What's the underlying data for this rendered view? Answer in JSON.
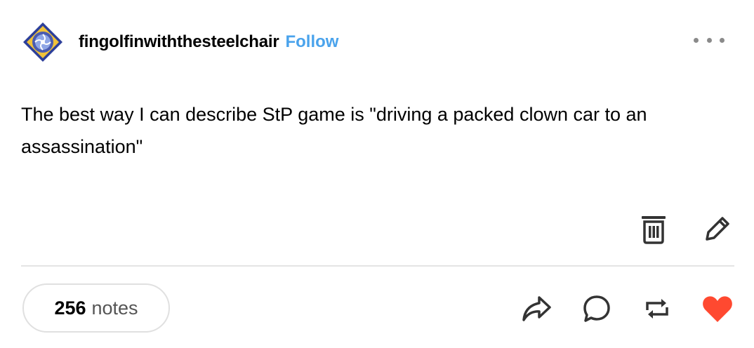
{
  "post": {
    "author": {
      "username": "fingolfinwiththesteelchair",
      "follow_label": "Follow",
      "avatar_icon": "avatar-emblem-icon"
    },
    "more_menu_icon": "more-horizontal-icon",
    "text": "The best way I can describe StP game is \"driving a packed clown car to an assassination\"",
    "owner_tools": {
      "delete_icon": "trash-icon",
      "edit_icon": "pencil-icon"
    },
    "footer": {
      "notes_count": "256",
      "notes_label": "notes",
      "actions": [
        "share-icon",
        "reply-icon",
        "reblog-icon",
        "like-icon"
      ]
    }
  },
  "colors": {
    "follow": "#4aa3ec",
    "like": "#ff4930",
    "icon": "#333333",
    "divider": "#e4e4e4",
    "pill_border": "#e0e0e0"
  }
}
